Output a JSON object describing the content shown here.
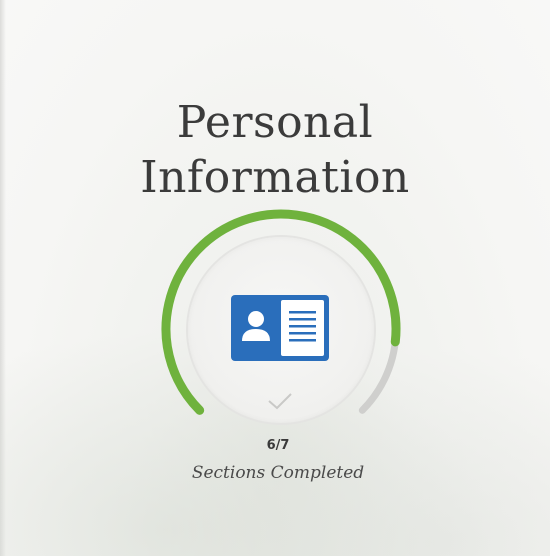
{
  "page": {
    "title_line1": "Personal",
    "title_line2": "Information"
  },
  "progress": {
    "completed": 6,
    "total": 7,
    "count_text": "6/7",
    "caption": "Sections Completed"
  },
  "icons": {
    "center": "id-card-icon",
    "status": "checkmark-icon"
  },
  "colors": {
    "progress_fill": "#6fb23d",
    "progress_track": "#cfcfcd",
    "icon_blue": "#2a6ebb",
    "title_text": "#3b3b3b"
  }
}
